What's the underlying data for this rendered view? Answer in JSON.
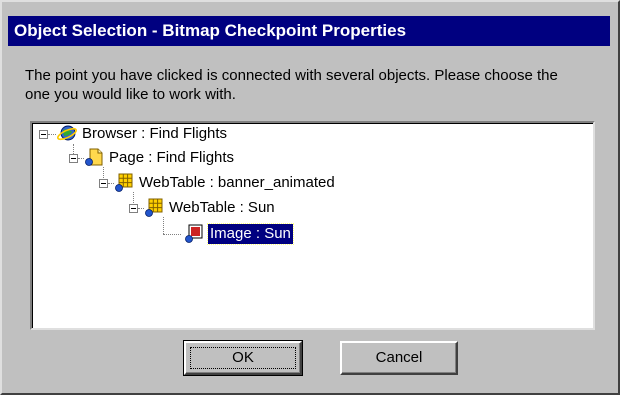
{
  "dialog": {
    "title": "Object Selection - Bitmap Checkpoint Properties",
    "message": "The point you have clicked is connected with several objects. Please choose the one you would like to work with."
  },
  "tree": {
    "nodes": [
      {
        "label": "Browser : Find Flights",
        "icon": "browser-icon",
        "level": 0,
        "expanded": true,
        "selected": false
      },
      {
        "label": "Page : Find Flights",
        "icon": "page-icon",
        "level": 1,
        "expanded": true,
        "selected": false
      },
      {
        "label": "WebTable : banner_animated",
        "icon": "webtable-icon",
        "level": 2,
        "expanded": true,
        "selected": false
      },
      {
        "label": "WebTable : Sun",
        "icon": "webtable-icon",
        "level": 3,
        "expanded": true,
        "selected": false
      },
      {
        "label": "Image : Sun",
        "icon": "image-icon",
        "level": 4,
        "expanded": false,
        "selected": true
      }
    ]
  },
  "buttons": {
    "ok_label": "OK",
    "cancel_label": "Cancel"
  },
  "colors": {
    "titlebar": "#000080",
    "selection": "#000080",
    "face": "#c0c0c0"
  }
}
